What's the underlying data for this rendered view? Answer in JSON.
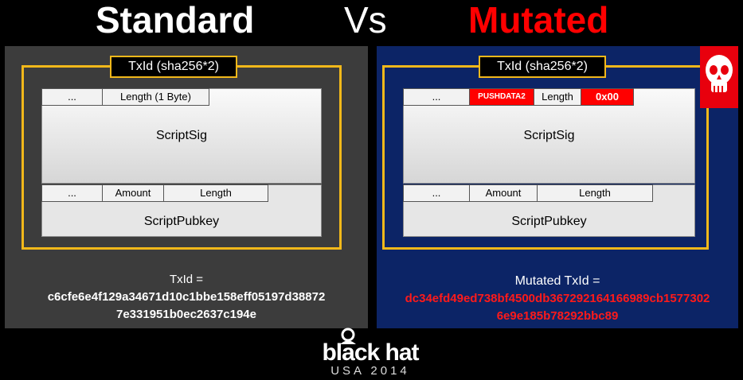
{
  "header": {
    "left_title": "Standard",
    "vs": "Vs",
    "right_title": "Mutated"
  },
  "standard": {
    "tag": "TxId (sha256*2)",
    "scriptsig_row": [
      "...",
      "Length (1 Byte)"
    ],
    "scriptsig_label": "ScriptSig",
    "pubkey_row": [
      "...",
      "Amount",
      "Length"
    ],
    "pubkey_label": "ScriptPubkey",
    "result_label": "TxId =",
    "result_line1": "c6cfe6e4f129a34671d10c1bbe158eff05197d38872",
    "result_line2": "7e331951b0ec2637c194e"
  },
  "mutated": {
    "tag": "TxId (sha256*2)",
    "scriptsig_row": [
      "...",
      "PUSHDATA2",
      "Length",
      "0x00"
    ],
    "scriptsig_label": "ScriptSig",
    "pubkey_row": [
      "...",
      "Amount",
      "Length"
    ],
    "pubkey_label": "ScriptPubkey",
    "result_label": "Mutated TxId =",
    "result_line1": "dc34efd49ed738bf4500db367292164166989cb1577302",
    "result_line2": "6e9e185b78292bbc89",
    "badge_icon": "skull-icon"
  },
  "footer": {
    "logo_main": "black hat",
    "logo_sub": "USA 2014",
    "logo_icon": "hat-icon"
  },
  "colors": {
    "background": "#000000",
    "standard_panel": "#3c3c3c",
    "mutated_panel": "#0c2466",
    "frame": "#f2b81a",
    "alert_red": "#ff0000"
  }
}
